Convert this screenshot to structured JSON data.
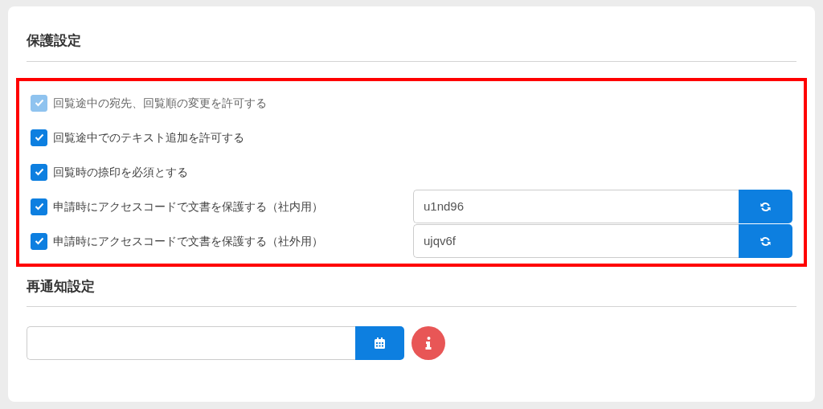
{
  "protection": {
    "title": "保護設定",
    "options": [
      {
        "kind": "checkbox",
        "label": "回覧途中の宛先、回覧順の変更を許可する",
        "checked": true,
        "disabled": true
      },
      {
        "kind": "checkbox",
        "label": "回覧途中でのテキスト追加を許可する",
        "checked": true,
        "disabled": false
      },
      {
        "kind": "checkbox",
        "label": "回覧時の捺印を必須とする",
        "checked": true,
        "disabled": false
      },
      {
        "kind": "code",
        "label": "申請時にアクセスコードで文書を保護する（社内用）",
        "checked": true,
        "disabled": false,
        "value": "u1nd96"
      },
      {
        "kind": "code",
        "label": "申請時にアクセスコードで文書を保護する（社外用）",
        "checked": true,
        "disabled": false,
        "value": "ujqv6f"
      }
    ]
  },
  "reminder": {
    "title": "再通知設定"
  }
}
